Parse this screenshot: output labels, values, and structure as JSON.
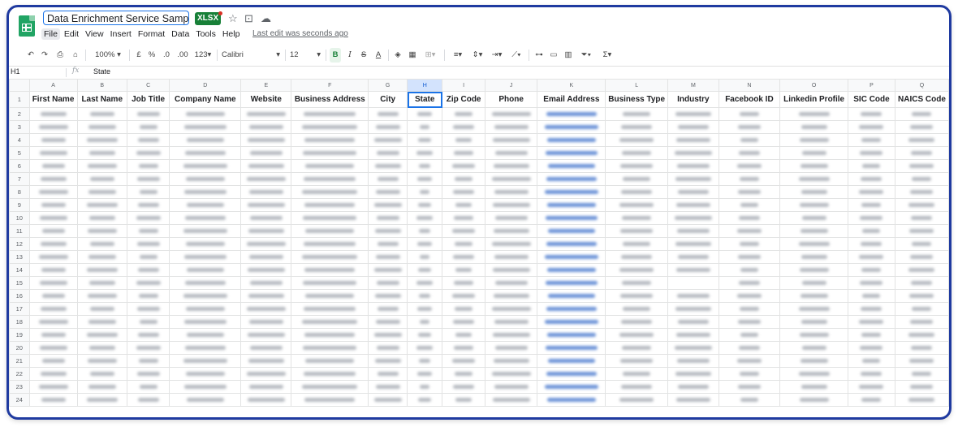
{
  "doc": {
    "title": "Data Enrichment Service Sample...",
    "badge": "XLSX",
    "last_edit": "Last edit was seconds ago"
  },
  "menu": [
    "File",
    "Edit",
    "View",
    "Insert",
    "Format",
    "Data",
    "Tools",
    "Help"
  ],
  "toolbar": {
    "zoom": "100%",
    "currency": "£",
    "percent": "%",
    "dec_less": ".0",
    "dec_more": ".00",
    "format_more": "123",
    "font": "Calibri",
    "font_size": "12",
    "bold": "B",
    "italic": "I",
    "strike": "S",
    "text_color": "A"
  },
  "formula_bar": {
    "cell_ref": "H1",
    "fx": "fx",
    "value": "State"
  },
  "columns": [
    "A",
    "B",
    "C",
    "D",
    "E",
    "F",
    "G",
    "H",
    "I",
    "J",
    "K",
    "L",
    "M",
    "N",
    "O",
    "P",
    "Q"
  ],
  "headers": [
    "First Name",
    "Last Name",
    "Job Title",
    "Company Name",
    "Website",
    "Business Address",
    "City",
    "State",
    "Zip Code",
    "Phone",
    "Email Address",
    "Business Type",
    "Industry",
    "Facebook ID",
    "Linkedin Profile",
    "SIC Code",
    "NAICS Code"
  ],
  "rows": [
    "1",
    "2",
    "3",
    "4",
    "5",
    "6",
    "7",
    "8",
    "9",
    "10",
    "11",
    "12",
    "13",
    "14",
    "15",
    "16",
    "17",
    "18",
    "19",
    "20",
    "21",
    "22",
    "23",
    "24"
  ],
  "selected_column": "H",
  "colors": {
    "frame": "#1f3aa0",
    "accent": "#1a73e8",
    "sheets_green": "#21a464",
    "xlsx_badge": "#188038"
  }
}
